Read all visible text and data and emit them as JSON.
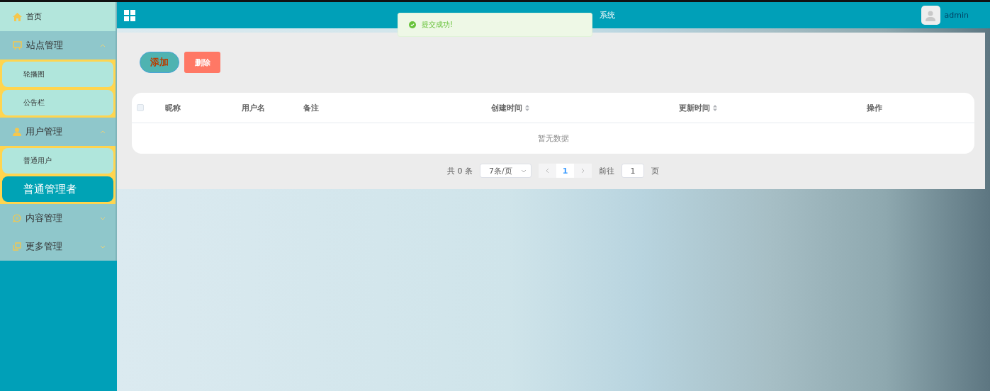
{
  "sidebar": {
    "items": [
      {
        "kind": "link",
        "label": "首页"
      },
      {
        "kind": "group",
        "label": "站点管理",
        "expanded": true,
        "children": [
          {
            "label": "轮播图",
            "selected": false
          },
          {
            "label": "公告栏",
            "selected": false
          }
        ]
      },
      {
        "kind": "group",
        "label": "用户管理",
        "expanded": true,
        "children": [
          {
            "label": "普通用户",
            "selected": false
          },
          {
            "label": "普通管理者",
            "selected": true
          }
        ]
      },
      {
        "kind": "group",
        "label": "内容管理",
        "expanded": false
      },
      {
        "kind": "group",
        "label": "更多管理",
        "expanded": false
      }
    ]
  },
  "header": {
    "title": "系统",
    "user": "admin"
  },
  "toast": {
    "message": "提交成功!"
  },
  "actions": [
    {
      "kind": "add",
      "label": "添加"
    },
    {
      "kind": "delete",
      "label": "删除"
    }
  ],
  "table": {
    "select_all": {
      "checked": false
    },
    "columns": [
      {
        "label": "昵称",
        "sortable": false
      },
      {
        "label": "用户名",
        "sortable": false
      },
      {
        "label": "备注",
        "sortable": false
      },
      {
        "label": "创建时间",
        "sortable": true
      },
      {
        "label": "更新时间",
        "sortable": true
      },
      {
        "label": "操作",
        "sortable": false
      }
    ],
    "empty_text": "暂无数据"
  },
  "pagination": {
    "total": "共 0 条",
    "page_size": "7条/页",
    "pages": [
      {
        "label": "1",
        "selected": true
      }
    ],
    "goto_label": "前往",
    "goto_value": "1",
    "goto_suffix": "页"
  }
}
